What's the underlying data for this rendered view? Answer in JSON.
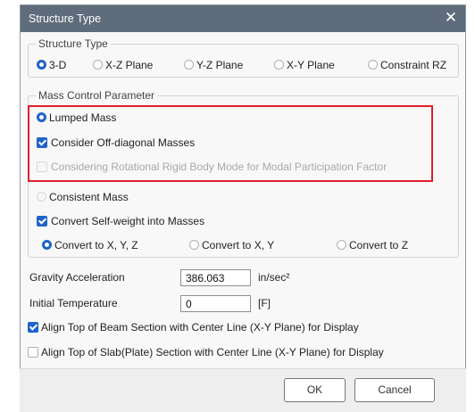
{
  "window": {
    "title": "Structure Type",
    "close_glyph": "✕"
  },
  "structure_type": {
    "legend": "Structure Type",
    "options": [
      {
        "label": "3-D",
        "checked": true
      },
      {
        "label": "X-Z Plane",
        "checked": false
      },
      {
        "label": "Y-Z Plane",
        "checked": false
      },
      {
        "label": "X-Y Plane",
        "checked": false
      },
      {
        "label": "Constraint RZ",
        "checked": false
      }
    ]
  },
  "mass_control": {
    "legend": "Mass Control Parameter",
    "lumped_mass": {
      "label": "Lumped Mass",
      "checked": true
    },
    "off_diagonal": {
      "label": "Consider Off-diagonal Masses",
      "checked": true
    },
    "rotational": {
      "label": "Considering Rotational Rigid Body Mode for Modal Participation Factor",
      "checked": false,
      "disabled": true
    },
    "consistent_mass": {
      "label": "Consistent Mass",
      "checked": false
    },
    "self_weight": {
      "label": "Convert Self-weight into Masses",
      "checked": true
    },
    "convert_options": [
      {
        "label": "Convert to X, Y, Z",
        "checked": true
      },
      {
        "label": "Convert to X, Y",
        "checked": false
      },
      {
        "label": "Convert to Z",
        "checked": false
      }
    ]
  },
  "gravity": {
    "label": "Gravity Acceleration",
    "value": "386.063",
    "unit": "in/sec²"
  },
  "temperature": {
    "label": "Initial Temperature",
    "value": "0",
    "unit": "[F]"
  },
  "align_beam": {
    "label": "Align Top of Beam Section with Center Line (X-Y Plane) for  Display",
    "checked": true
  },
  "align_slab": {
    "label": "Align Top of Slab(Plate) Section with Center Line (X-Y Plane) for Display",
    "checked": false
  },
  "buttons": {
    "ok": "OK",
    "cancel": "Cancel"
  },
  "colors": {
    "titlebar": "#5f6c7b",
    "accent": "#1f63c9",
    "highlight": "#e01f2a"
  },
  "icons": {
    "close": "close-icon",
    "radio": "radio-icon",
    "checkbox": "checkbox-icon"
  }
}
